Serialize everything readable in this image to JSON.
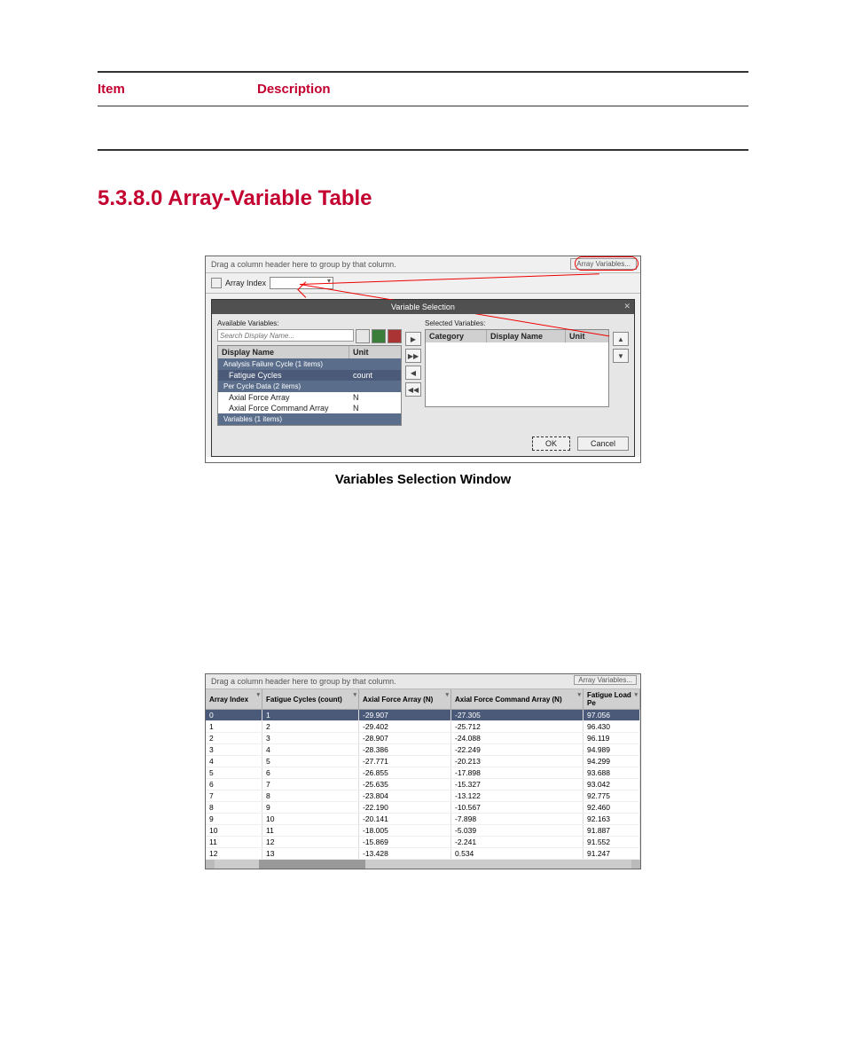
{
  "def_header": {
    "item": "Item",
    "description": "Description"
  },
  "section_title": "5.3.8.0 Array-Variable Table",
  "caption1": "Variables Selection Window",
  "fig1": {
    "group_hint": "Drag a column header here to group by that column.",
    "array_variables_btn": "Array Variables...",
    "array_index_label": "Array Index",
    "dialog_title": "Variable Selection",
    "available_label": "Available Variables:",
    "selected_label": "Selected Variables:",
    "search_placeholder": "Search Display Name...",
    "th_display_name": "Display Name",
    "th_unit": "Unit",
    "group_analysis": "Analysis Failure Cycle (1 items)",
    "row_fatigue": {
      "name": "Fatigue Cycles",
      "unit": "count"
    },
    "group_percycle": "Per Cycle Data (2 items)",
    "row_afa": {
      "name": "Axial Force Array",
      "unit": "N"
    },
    "row_afca": {
      "name": "Axial Force Command Array",
      "unit": "N"
    },
    "group_vars": "Variables (1 items)",
    "sel_th_category": "Category",
    "sel_th_display": "Display Name",
    "sel_th_unit": "Unit",
    "ok": "OK",
    "cancel": "Cancel"
  },
  "fig2": {
    "group_hint": "Drag a column header here to group by that column.",
    "array_variables_btn": "Array Variables...",
    "columns": {
      "array_index": "Array Index",
      "fatigue_cycles": "Fatigue Cycles (count)",
      "axial_force_array": "Axial Force Array (N)",
      "axial_force_command": "Axial Force Command Array (N)",
      "fatigue_load_pe": "Fatigue Load Pe"
    },
    "rows": [
      {
        "ai": "0",
        "fc": "1",
        "af": "-29.907",
        "ac": "-27.305",
        "flp": "97.056"
      },
      {
        "ai": "1",
        "fc": "2",
        "af": "-29.402",
        "ac": "-25.712",
        "flp": "96.430"
      },
      {
        "ai": "2",
        "fc": "3",
        "af": "-28.907",
        "ac": "-24.088",
        "flp": "96.119"
      },
      {
        "ai": "3",
        "fc": "4",
        "af": "-28.386",
        "ac": "-22.249",
        "flp": "94.989"
      },
      {
        "ai": "4",
        "fc": "5",
        "af": "-27.771",
        "ac": "-20.213",
        "flp": "94.299"
      },
      {
        "ai": "5",
        "fc": "6",
        "af": "-26.855",
        "ac": "-17.898",
        "flp": "93.688"
      },
      {
        "ai": "6",
        "fc": "7",
        "af": "-25.635",
        "ac": "-15.327",
        "flp": "93.042"
      },
      {
        "ai": "7",
        "fc": "8",
        "af": "-23.804",
        "ac": "-13.122",
        "flp": "92.775"
      },
      {
        "ai": "8",
        "fc": "9",
        "af": "-22.190",
        "ac": "-10.567",
        "flp": "92.460"
      },
      {
        "ai": "9",
        "fc": "10",
        "af": "-20.141",
        "ac": "-7.898",
        "flp": "92.163"
      },
      {
        "ai": "10",
        "fc": "11",
        "af": "-18.005",
        "ac": "-5.039",
        "flp": "91.887"
      },
      {
        "ai": "11",
        "fc": "12",
        "af": "-15.869",
        "ac": "-2.241",
        "flp": "91.552"
      },
      {
        "ai": "12",
        "fc": "13",
        "af": "-13.428",
        "ac": "0.534",
        "flp": "91.247"
      }
    ]
  }
}
